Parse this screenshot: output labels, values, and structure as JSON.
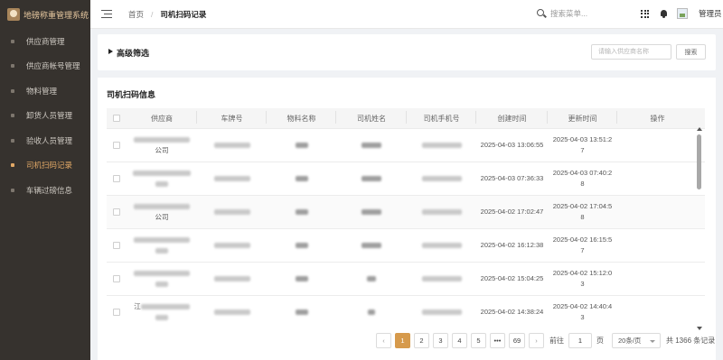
{
  "app": {
    "title": "地磅称重管理系统"
  },
  "sidebar": {
    "items": [
      {
        "label": "供应商管理",
        "active": false
      },
      {
        "label": "供应商帐号管理",
        "active": false
      },
      {
        "label": "物料管理",
        "active": false
      },
      {
        "label": "卸货人员管理",
        "active": false
      },
      {
        "label": "验收人员管理",
        "active": false
      },
      {
        "label": "司机扫码记录",
        "active": true
      },
      {
        "label": "车辆过磅信息",
        "active": false
      }
    ]
  },
  "header": {
    "breadcrumb_home": "首页",
    "breadcrumb_current": "司机扫码记录",
    "search_placeholder": "搜索菜单...",
    "username": "管理员"
  },
  "filter": {
    "title": "高级筛选",
    "input_placeholder": "请输入供应商名称",
    "search_button": "搜索"
  },
  "table": {
    "title": "司机扫码信息",
    "columns": [
      "供应商",
      "车牌号",
      "物料名称",
      "司机姓名",
      "司机手机号",
      "创建时间",
      "更新时间",
      "操作"
    ],
    "rows": [
      {
        "supplier_tail": "公司",
        "created": "2025-04-03 13:06:55",
        "updated": "2025-04-03 13:51:27"
      },
      {
        "supplier_tail": "",
        "created": "2025-04-03 07:36:33",
        "updated": "2025-04-03 07:40:28"
      },
      {
        "supplier_tail": "公司",
        "created": "2025-04-02 17:02:47",
        "updated": "2025-04-02 17:04:58"
      },
      {
        "supplier_tail": "",
        "created": "2025-04-02 16:12:38",
        "updated": "2025-04-02 16:15:57"
      },
      {
        "supplier_tail": "",
        "created": "2025-04-02 15:04:25",
        "updated": "2025-04-02 15:12:03"
      },
      {
        "supplier_tail": "江",
        "created": "2025-04-02 14:38:24",
        "updated": "2025-04-02 14:40:43"
      }
    ]
  },
  "pagination": {
    "pages": [
      "1",
      "2",
      "3",
      "4",
      "5",
      "•••",
      "69"
    ],
    "current_page": "1",
    "prev_icon": "chevron-left-icon",
    "next_icon": "chevron-right-icon",
    "goto_label": "前往",
    "goto_value": "1",
    "page_unit": "页",
    "page_size": "20条/页",
    "total": "共 1366 条记录"
  },
  "colors": {
    "sidebar_bg": "#36322e",
    "accent": "#d69a4c",
    "active_nav": "#e2a866"
  }
}
